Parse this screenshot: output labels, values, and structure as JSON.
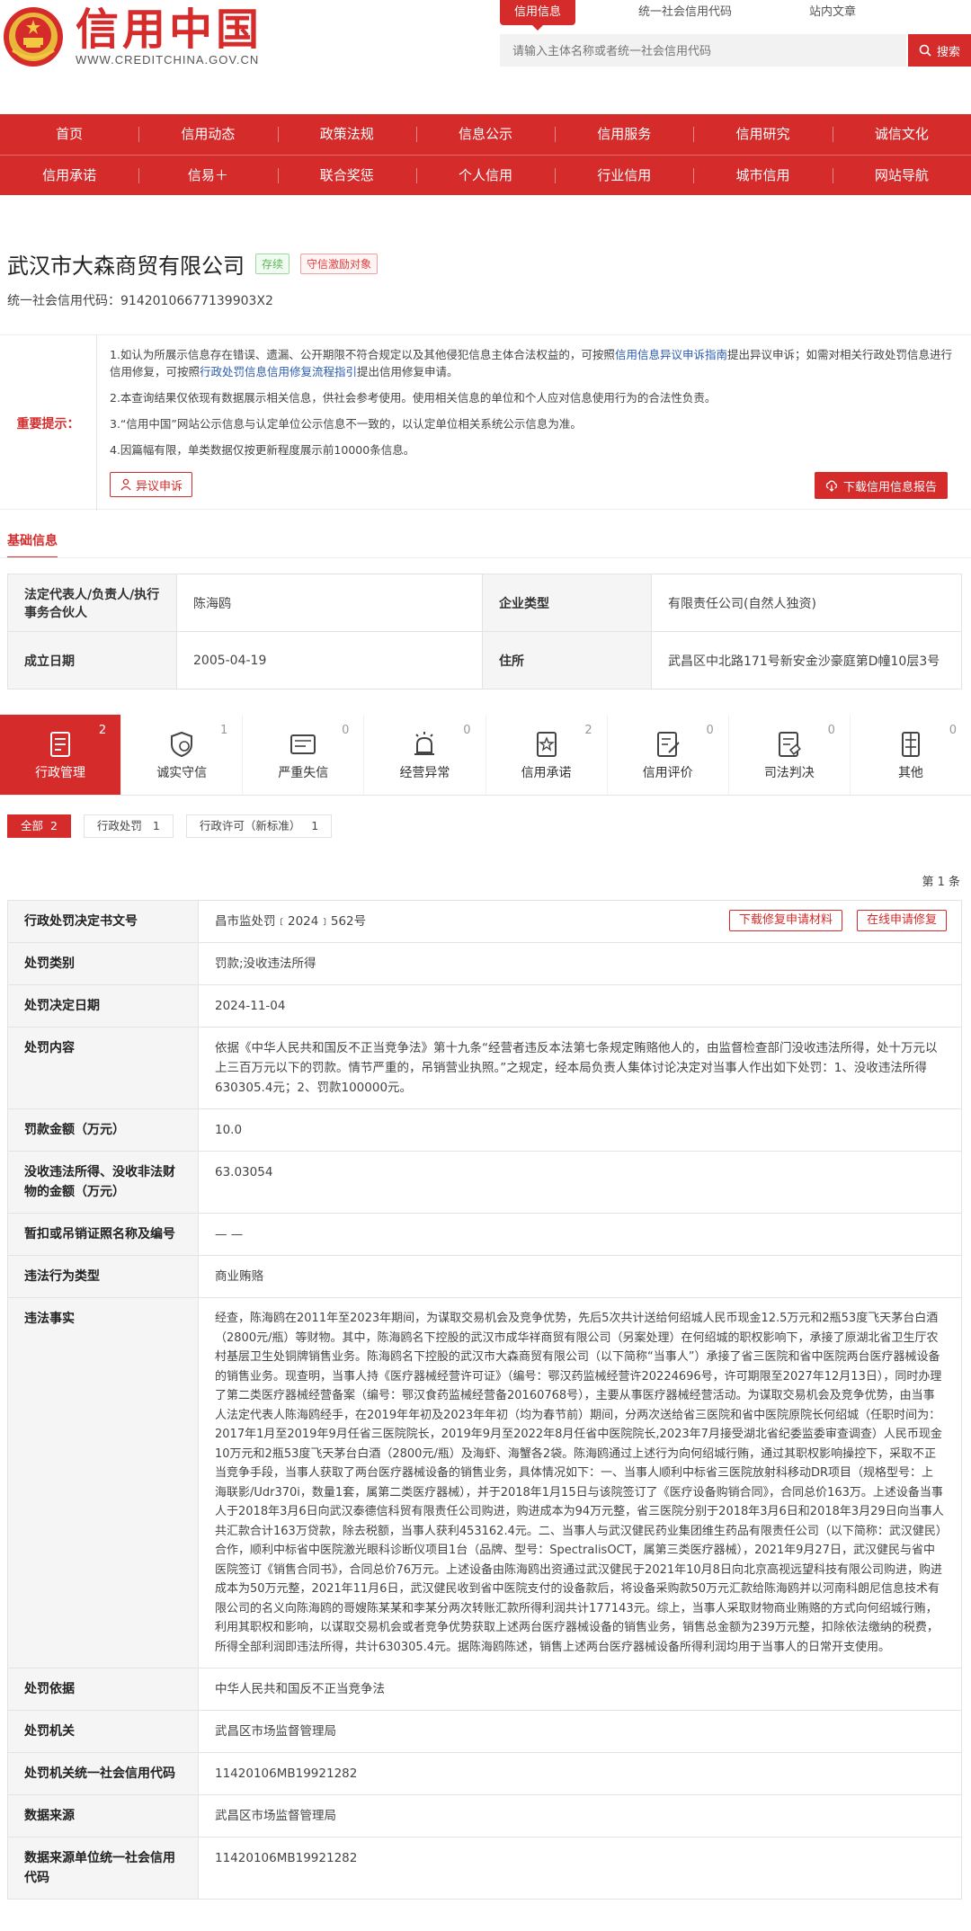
{
  "header": {
    "logo_title": "信用中国",
    "logo_url": "WWW.CREDITCHINA.GOV.CN",
    "tabs": [
      {
        "label": "信用信息",
        "active": true
      },
      {
        "label": "统一社会信用代码",
        "active": false
      },
      {
        "label": "站内文章",
        "active": false
      }
    ],
    "search_placeholder": "请输入主体名称或者统一社会信用代码",
    "search_button": "搜索"
  },
  "nav": {
    "row1": [
      "首页",
      "信用动态",
      "政策法规",
      "信息公示",
      "信用服务",
      "信用研究",
      "诚信文化"
    ],
    "row2": [
      "信用承诺",
      "信易＋",
      "联合奖惩",
      "个人信用",
      "行业信用",
      "城市信用",
      "网站导航"
    ]
  },
  "company": {
    "name": "武汉市大森商贸有限公司",
    "tag_status": "存续",
    "tag_incentive": "守信激励对象",
    "code_label": "统一社会信用代码：",
    "code": "91420106677139903X2"
  },
  "notice": {
    "label": "重要提示：",
    "p1_a": "1.如认为所展示信息存在错误、遗漏、公开期限不符合规定以及其他侵犯信息主体合法权益的，可按照",
    "p1_link1": "信用信息异议申诉指南",
    "p1_b": "提出异议申诉；如需对相关行政处罚信息进行信用修复，可按照",
    "p1_link2": "行政处罚信息信用修复流程指引",
    "p1_c": "提出信用修复申请。",
    "p2": "2.本查询结果仅依现有数据展示相关信息，供社会参考使用。使用相关信息的单位和个人应对信息使用行为的合法性负责。",
    "p3": "3.“信用中国”网站公示信息与认定单位公示信息不一致的，以认定单位相关系统公示信息为准。",
    "p4": "4.因篇幅有限，单类数据仅按更新程度展示前10000条信息。",
    "appeal_button": "异议申诉",
    "download_button": "下载信用信息报告"
  },
  "basic": {
    "title": "基础信息",
    "rows": [
      {
        "k1": "法定代表人/负责人/执行事务合伙人",
        "v1": "陈海鸥",
        "k2": "企业类型",
        "v2": "有限责任公司(自然人独资)"
      },
      {
        "k1": "成立日期",
        "v1": "2005-04-19",
        "k2": "住所",
        "v2": "武昌区中北路171号新安金沙豪庭第D幢10层3号"
      }
    ]
  },
  "categories": [
    {
      "label": "行政管理",
      "count": "2",
      "icon": "admin-icon",
      "active": true
    },
    {
      "label": "诚实守信",
      "count": "1",
      "icon": "honesty-shield-icon",
      "active": false
    },
    {
      "label": "严重失信",
      "count": "0",
      "icon": "dishonest-list-icon",
      "active": false
    },
    {
      "label": "经营异常",
      "count": "0",
      "icon": "alarm-icon",
      "active": false
    },
    {
      "label": "信用承诺",
      "count": "2",
      "icon": "promise-icon",
      "active": false
    },
    {
      "label": "信用评价",
      "count": "0",
      "icon": "evaluation-icon",
      "active": false
    },
    {
      "label": "司法判决",
      "count": "0",
      "icon": "judgment-icon",
      "active": false
    },
    {
      "label": "其他",
      "count": "0",
      "icon": "other-icon",
      "active": false
    }
  ],
  "filters": [
    {
      "label": "全部",
      "count": "2",
      "active": true
    },
    {
      "label": "行政处罚",
      "count": "1",
      "active": false
    },
    {
      "label": "行政许可（新标准）",
      "count": "1",
      "active": false
    }
  ],
  "page_indicator": "第 1 条",
  "detail": {
    "btn_download": "下载修复申请材料",
    "btn_online": "在线申请修复",
    "rows": [
      {
        "k": "行政处罚决定书文号",
        "v": "昌市监处罚﹝2024﹞562号"
      },
      {
        "k": "处罚类别",
        "v": "罚款;没收违法所得"
      },
      {
        "k": "处罚决定日期",
        "v": "2024-11-04"
      },
      {
        "k": "处罚内容",
        "v": "依据《中华人民共和国反不正当竞争法》第十九条“经营者违反本法第七条规定贿赂他人的，由监督检查部门没收违法所得，处十万元以上三百万元以下的罚款。情节严重的，吊销营业执照。”之规定，经本局负责人集体讨论决定对当事人作出如下处罚：1、没收违法所得630305.4元；2、罚款100000元。"
      },
      {
        "k": "罚款金额（万元）",
        "v": "10.0"
      },
      {
        "k": "没收违法所得、没收非法财物的金额（万元）",
        "v": "63.03054"
      },
      {
        "k": "暂扣或吊销证照名称及编号",
        "v": "— —"
      },
      {
        "k": "违法行为类型",
        "v": "商业贿赂"
      },
      {
        "k": "违法事实",
        "v": "经查，陈海鸥在2011年至2023年期间，为谋取交易机会及竞争优势，先后5次共计送给何绍城人民币现金12.5万元和2瓶53度飞天茅台白酒（2800元/瓶）等财物。其中，陈海鸥名下控股的武汉市成华祥商贸有限公司（另案处理）在何绍城的职权影响下，承接了原湖北省卫生厅农村基层卫生处铜牌销售业务。陈海鸥名下控股的武汉市大森商贸有限公司（以下简称“当事人”）承接了省三医院和省中医院两台医疗器械设备的销售业务。现查明，当事人持《医疗器械经营许可证》（编号：鄂汉药监械经营许20224696号，许可期限至2027年12月13日），同时办理了第二类医疗器械经营备案（编号：鄂汉食药监械经营备20160768号），主要从事医疗器械经营活动。为谋取交易机会及竞争优势，由当事人法定代表人陈海鸥经手，在2019年年初及2023年年初（均为春节前）期间，分两次送给省三医院和省中医院原院长何绍城（任职时间为：2017年1月至2019年9月任省三医院院长，2019年9月至2022年8月任省中医院院长,2023年7月接受湖北省纪委监委审查调查）人民币现金10万元和2瓶53度飞天茅台白酒（2800元/瓶）及海虾、海蟹各2袋。陈海鸥通过上述行为向何绍城行贿，通过其职权影响操控下，采取不正当竞争手段，当事人获取了两台医疗器械设备的销售业务，具体情况如下：一、当事人顺利中标省三医院放射科移动DR项目（规格型号：上海联影/Udr370i，数量1套，属第二类医疗器械），并于2018年1月15日与该院签订了《医疗设备购销合同》，合同总价163万。上述设备当事人于2018年3月6日向武汉泰德信科贸有限责任公司购进，购进成本为94万元整，省三医院分别于2018年3月6日和2018年3月29日向当事人共汇款合计163万贷款，除去税额，当事人获利453162.4元。二、当事人与武汉健民药业集团维生药品有限责任公司（以下简称：武汉健民）合作，顺利中标省中医院激光眼科诊断仪项目1台（品牌、型号：SpectralisOCT，属第三类医疗器械），2021年9月27日，武汉健民与省中医院签订《销售合同书》，合同总价76万元。上述设备由陈海鸥出资通过武汉健民于2021年10月8日向北京高视远望科技有限公司购进，购进成本为50万元整，2021年11月6日，武汉健民收到省中医院支付的设备款后，将设备采购款50万元汇款给陈海鸥并以河南科朗尼信息技术有限公司的名义向陈海鸥的哥嫂陈某某和李某分两次转账汇款所得利润共计177143元。综上，当事人采取财物商业贿赂的方式向何绍城行贿，利用其职权和影响，以谋取交易机会或者竞争优势获取上述两台医疗器械设备的销售业务，销售总金额为239万元整，扣除依法缴纳的税费，所得全部利润即违法所得，共计630305.4元。据陈海鸥陈述，销售上述两台医疗器械设备所得利润均用于当事人的日常开支使用。"
      },
      {
        "k": "处罚依据",
        "v": "中华人民共和国反不正当竞争法"
      },
      {
        "k": "处罚机关",
        "v": "武昌区市场监督管理局"
      },
      {
        "k": "处罚机关统一社会信用代码",
        "v": "11420106MB19921282"
      },
      {
        "k": "数据来源",
        "v": "武昌区市场监督管理局"
      },
      {
        "k": "数据来源单位统一社会信用代码",
        "v": "11420106MB19921282"
      }
    ]
  },
  "colors": {
    "brand_red": "#d52b2b",
    "link_blue": "#2a5bb0",
    "tag_green": "#5cb85c"
  }
}
